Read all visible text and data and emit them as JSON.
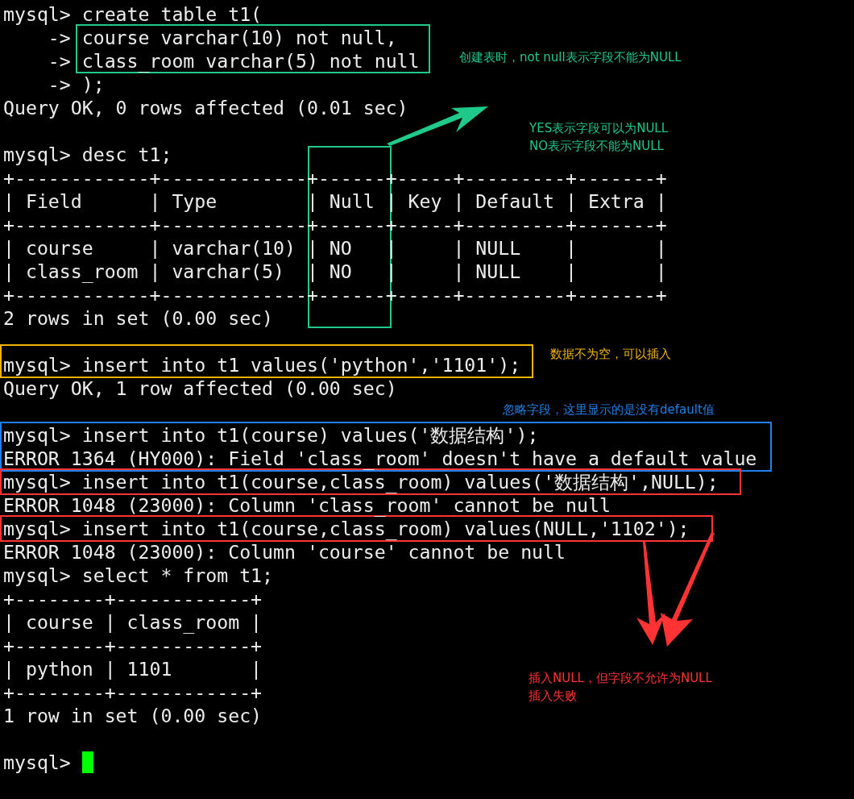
{
  "terminal": {
    "lines": [
      {
        "kind": "text",
        "text": "mysql> create table t1("
      },
      {
        "kind": "text",
        "text": "    -> course varchar(10) not null,"
      },
      {
        "kind": "text",
        "text": "    -> class_room varchar(5) not null"
      },
      {
        "kind": "text",
        "text": "    -> );"
      },
      {
        "kind": "text",
        "text": "Query OK, 0 rows affected (0.01 sec)"
      },
      {
        "kind": "blank"
      },
      {
        "kind": "text",
        "text": "mysql> desc t1;"
      },
      {
        "kind": "text",
        "text": "+------------+-------------+------+-----+---------+-------+"
      },
      {
        "kind": "text",
        "text": "| Field      | Type        | Null | Key | Default | Extra |"
      },
      {
        "kind": "text",
        "text": "+------------+-------------+------+-----+---------+-------+"
      },
      {
        "kind": "text",
        "text": "| course     | varchar(10) | NO   |     | NULL    |       |"
      },
      {
        "kind": "text",
        "text": "| class_room | varchar(5)  | NO   |     | NULL    |       |"
      },
      {
        "kind": "text",
        "text": "+------------+-------------+------+-----+---------+-------+"
      },
      {
        "kind": "text",
        "text": "2 rows in set (0.00 sec)"
      },
      {
        "kind": "blank"
      },
      {
        "kind": "text",
        "text": "mysql> insert into t1 values('python','1101');"
      },
      {
        "kind": "text",
        "text": "Query OK, 1 row affected (0.00 sec)"
      },
      {
        "kind": "blank"
      },
      {
        "kind": "text",
        "text": "mysql> insert into t1(course) values('数据结构');"
      },
      {
        "kind": "text",
        "text": "ERROR 1364 (HY000): Field 'class_room' doesn't have a default value"
      },
      {
        "kind": "text",
        "text": "mysql> insert into t1(course,class_room) values('数据结构',NULL);"
      },
      {
        "kind": "text",
        "text": "ERROR 1048 (23000): Column 'class_room' cannot be null"
      },
      {
        "kind": "text",
        "text": "mysql> insert into t1(course,class_room) values(NULL,'1102');"
      },
      {
        "kind": "text",
        "text": "ERROR 1048 (23000): Column 'course' cannot be null"
      },
      {
        "kind": "text",
        "text": "mysql> select * from t1;"
      },
      {
        "kind": "text",
        "text": "+--------+------------+"
      },
      {
        "kind": "text",
        "text": "| course | class_room |"
      },
      {
        "kind": "text",
        "text": "+--------+------------+"
      },
      {
        "kind": "text",
        "text": "| python | 1101       |"
      },
      {
        "kind": "text",
        "text": "+--------+------------+"
      },
      {
        "kind": "text",
        "text": "1 row in set (0.00 sec)"
      },
      {
        "kind": "blank"
      },
      {
        "kind": "prompt",
        "text": "mysql> "
      }
    ]
  },
  "annotations": [
    {
      "color": "#1ec98a",
      "lines": [
        "创建表时，not null表示字段不能为NULL"
      ]
    },
    {
      "color": "#1ec98a",
      "lines": [
        "YES表示字段可以为NULL",
        "NO表示字段不能为NULL"
      ]
    },
    {
      "color": "#f0b400",
      "lines": [
        "数据不为空，可以插入"
      ]
    },
    {
      "color": "#1e80e8",
      "lines": [
        "忽略字段，这里显示的是没有default值"
      ]
    },
    {
      "color": "#ff3333",
      "lines": [
        "插入NULL，但字段不允许为NULL",
        "插入失败"
      ]
    }
  ]
}
